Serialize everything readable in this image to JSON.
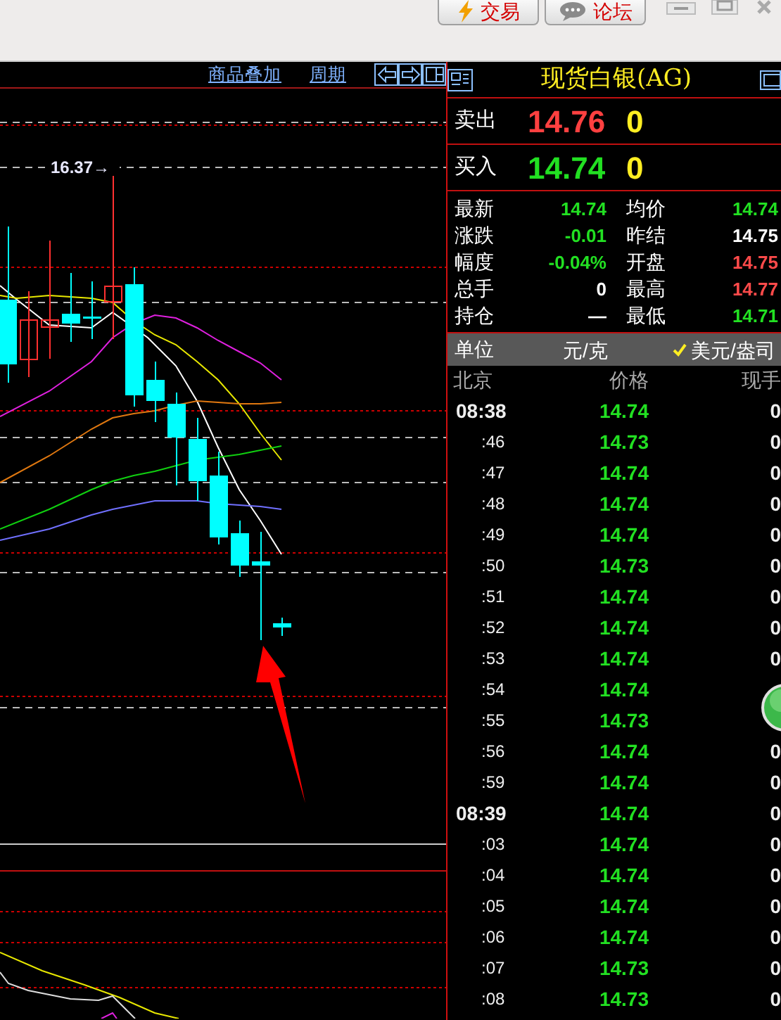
{
  "toolbar": {
    "buttons": [
      {
        "label": "交易",
        "kind": "trade"
      },
      {
        "label": "论坛",
        "kind": "forum"
      }
    ]
  },
  "chart": {
    "links": [
      "商品叠加",
      "周期"
    ],
    "high_label": "16.37→"
  },
  "quote": {
    "title": "现货白银(AG)",
    "orders": [
      {
        "label": "卖出",
        "price": "14.76",
        "volume": "0",
        "color": "#ff4040"
      },
      {
        "label": "买入",
        "price": "14.74",
        "volume": "0",
        "color": "#22e022"
      }
    ],
    "stats": [
      {
        "label": "最新",
        "value": "14.74",
        "color": "#22e022"
      },
      {
        "label": "均价",
        "value": "14.74",
        "color": "#22e022"
      },
      {
        "label": "涨跌",
        "value": "-0.01",
        "color": "#22e022"
      },
      {
        "label": "昨结",
        "value": "14.75",
        "color": "#ffffff"
      },
      {
        "label": "幅度",
        "value": "-0.04%",
        "color": "#22e022"
      },
      {
        "label": "开盘",
        "value": "14.75",
        "color": "#ff4a4a"
      },
      {
        "label": "总手",
        "value": "0",
        "color": "#ffffff"
      },
      {
        "label": "最高",
        "value": "14.77",
        "color": "#ff4a4a"
      },
      {
        "label": "持仓",
        "value": "—",
        "color": "#ffffff"
      },
      {
        "label": "最低",
        "value": "14.71",
        "color": "#22e022"
      }
    ],
    "unit": {
      "label": "单位",
      "options": [
        {
          "label": "元/克",
          "selected": false
        },
        {
          "label": "美元/盎司",
          "selected": true
        }
      ]
    },
    "ticks": {
      "columns": [
        "北京",
        "价格",
        "现手"
      ],
      "rows": [
        {
          "time": "08:38",
          "kind": "hour",
          "price": "14.74",
          "volume": "0"
        },
        {
          "time": ":46",
          "kind": "minute",
          "price": "14.73",
          "volume": "0"
        },
        {
          "time": ":47",
          "kind": "minute",
          "price": "14.74",
          "volume": "0"
        },
        {
          "time": ":48",
          "kind": "minute",
          "price": "14.74",
          "volume": "0"
        },
        {
          "time": ":49",
          "kind": "minute",
          "price": "14.74",
          "volume": "0"
        },
        {
          "time": ":50",
          "kind": "minute",
          "price": "14.73",
          "volume": "0"
        },
        {
          "time": ":51",
          "kind": "minute",
          "price": "14.74",
          "volume": "0"
        },
        {
          "time": ":52",
          "kind": "minute",
          "price": "14.74",
          "volume": "0"
        },
        {
          "time": ":53",
          "kind": "minute",
          "price": "14.74",
          "volume": "0"
        },
        {
          "time": ":54",
          "kind": "minute",
          "price": "14.74"
        },
        {
          "time": ":55",
          "kind": "minute",
          "price": "14.73"
        },
        {
          "time": ":56",
          "kind": "minute",
          "price": "14.74",
          "volume": "0"
        },
        {
          "time": ":59",
          "kind": "minute",
          "price": "14.74",
          "volume": "0"
        },
        {
          "time": "08:39",
          "kind": "hour",
          "price": "14.74",
          "volume": "0"
        },
        {
          "time": ":03",
          "kind": "minute",
          "price": "14.74",
          "volume": "0"
        },
        {
          "time": ":04",
          "kind": "minute",
          "price": "14.74",
          "volume": "0"
        },
        {
          "time": ":05",
          "kind": "minute",
          "price": "14.74",
          "volume": "0"
        },
        {
          "time": ":06",
          "kind": "minute",
          "price": "14.74",
          "volume": "0"
        },
        {
          "time": ":07",
          "kind": "minute",
          "price": "14.73",
          "volume": "0"
        },
        {
          "time": ":08",
          "kind": "minute",
          "price": "14.73",
          "volume": "0"
        }
      ]
    }
  }
}
